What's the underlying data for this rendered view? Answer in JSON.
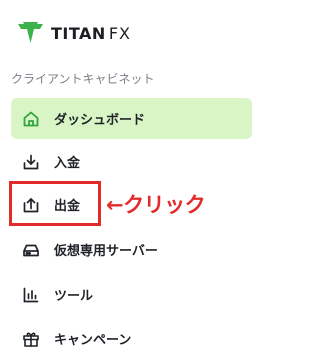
{
  "brand": {
    "logo_text": "TITAN",
    "logo_suffix": "FX",
    "logo_icon": "titan-shield-icon",
    "accent": "#3cb34a"
  },
  "sidebar": {
    "section_label": "クライアントキャビネット",
    "items": [
      {
        "label": "ダッシュボード",
        "icon": "home-icon",
        "active": true
      },
      {
        "label": "入金",
        "icon": "deposit-icon"
      },
      {
        "label": "出金",
        "icon": "withdraw-icon"
      },
      {
        "label": "仮想専用サーバー",
        "icon": "server-icon"
      },
      {
        "label": "ツール",
        "icon": "chart-icon"
      },
      {
        "label": "キャンペーン",
        "icon": "gift-icon"
      }
    ]
  },
  "annotation": {
    "text": "←クリック",
    "color": "#e32a2a"
  },
  "colors": {
    "active_bg": "#d9f5c6",
    "active_icon": "#2fa33d",
    "text": "#1f2328",
    "muted": "#7a7e85"
  }
}
